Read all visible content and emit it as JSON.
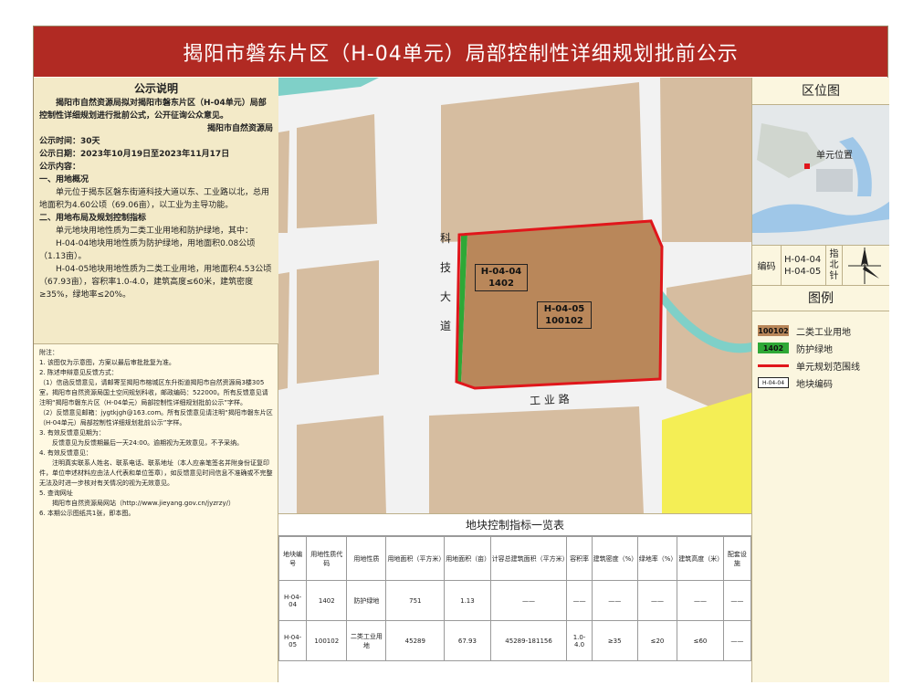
{
  "title": "揭阳市磐东片区（H-04单元）局部控制性详细规划批前公示",
  "notice": {
    "heading": "公示说明",
    "intro": "揭阳市自然资源局拟对揭阳市磐东片区（H-04单元）局部控制性详细规划进行批前公式，公开征询公众意见。",
    "issuer": "揭阳市自然资源局",
    "period": "公示时间：30天",
    "dates": "公示日期：2023年10月19日至2023年11月17日",
    "content_label": "公示内容：",
    "sec1_title": "一、用地概况",
    "sec1_text": "单元位于揭东区磐东街道科技大道以东、工业路以北，总用地面积为4.60公顷（69.06亩），以工业为主导功能。",
    "sec2_title": "二、用地布局及规划控制指标",
    "sec2_text1": "单元地块用地性质为二类工业用地和防护绿地，其中：",
    "sec2_text2": "H-04-04地块用地性质为防护绿地，用地面积0.08公顷（1.13亩）。",
    "sec2_text3": "H-04-05地块用地性质为二类工业用地，用地面积4.53公顷（67.93亩），容积率1.0-4.0，建筑高度≤60米，建筑密度≥35%，绿地率≤20%。"
  },
  "notes": [
    "附注：",
    "1. 该图仅为示意图，方案以最后审批批复为准。",
    "2. 陈述申辩意见反馈方式：",
    "（1）信函反馈意见，请邮寄至揭阳市榕城区东升街道揭阳市自然资源局3楼305室，揭阳市自然资源局国土空间规划科收，邮政编码：522000。所有反馈意见请注明“揭阳市磐东片区（H-04单元）局部控制性详细规划批前公示”字样。",
    "（2）反馈意见邮箱：jygtkjgh@163.com。所有反馈意见请注明“揭阳市磐东片区（H-04单元）局部控制性详细规划批前公示”字样。",
    "3. 有效反馈意见期为：",
    "反馈意见为反馈期最后一天24:00。逾期视为无效意见，不予采纳。",
    "4. 有效反馈意见：",
    "注明真实联系人姓名、联系电话、联系地址（本人应亲笔签名并附身份证复印件，单位申述材料应由法人代表和单位签章），如反馈意见时间信息不准确或不完整无法及时进一步核对有关情况的视为无效意见。",
    "5. 查询网址",
    "揭阳市自然资源局网站（http://www.jieyang.gov.cn/jyzrzy/）",
    "6. 本期公示图纸共1张，即本图。"
  ],
  "map": {
    "road1": [
      "科",
      "技",
      "大",
      "道"
    ],
    "road2": "工 业 路",
    "block1_code": "H-04-04",
    "block1_num": "1402",
    "block2_code": "H-04-05",
    "block2_num": "100102"
  },
  "right": {
    "location_title": "区位图",
    "unit_location": "单元位置",
    "code_label": "编码",
    "codes": [
      "H-04-04",
      "H-04-05"
    ],
    "north_label": [
      "指",
      "北",
      "针"
    ],
    "legend_title": "图例",
    "legend": [
      {
        "swatch": "100102",
        "label": "二类工业用地",
        "color": "#b9875a"
      },
      {
        "swatch": "1402",
        "label": "防护绿地",
        "color": "#2ea836"
      },
      {
        "swatch": "",
        "label": "单元规划范围线",
        "color": "#e0161b"
      },
      {
        "swatch": "H-04-04",
        "label": "地块编码",
        "color": "#ffffff"
      }
    ]
  },
  "table": {
    "title": "地块控制指标一览表",
    "headers": [
      "地块编号",
      "用地性质代码",
      "用地性质",
      "用地面积（平方米）",
      "用地面积（亩）",
      "计容总建筑面积（平方米）",
      "容积率",
      "建筑密度（%）",
      "绿地率（%）",
      "建筑高度（米）",
      "配套设施"
    ],
    "rows": [
      [
        "H-04-04",
        "1402",
        "防护绿地",
        "751",
        "1.13",
        "——",
        "——",
        "——",
        "——",
        "——",
        "——"
      ],
      [
        "H-04-05",
        "100102",
        "二类工业用地",
        "45289",
        "67.93",
        "45289-181156",
        "1.0-4.0",
        "≥35",
        "≤20",
        "≤60",
        "——"
      ]
    ]
  },
  "colors": {
    "title_bg": "#b12a23",
    "industrial": "#b9875a",
    "green": "#2ea836",
    "boundary": "#e0161b",
    "parcel": "#d6bda0",
    "yellow": "#f4ee55",
    "water": "#7fd0c8"
  }
}
